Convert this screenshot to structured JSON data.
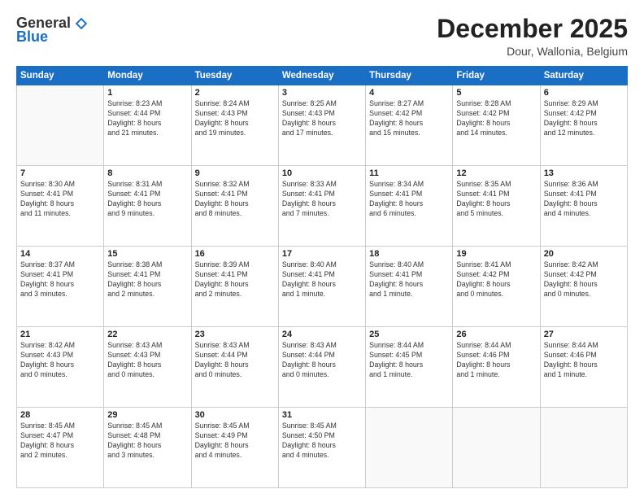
{
  "logo": {
    "general": "General",
    "blue": "Blue"
  },
  "title": "December 2025",
  "subtitle": "Dour, Wallonia, Belgium",
  "days_of_week": [
    "Sunday",
    "Monday",
    "Tuesday",
    "Wednesday",
    "Thursday",
    "Friday",
    "Saturday"
  ],
  "weeks": [
    [
      {
        "day": "",
        "info": ""
      },
      {
        "day": "1",
        "info": "Sunrise: 8:23 AM\nSunset: 4:44 PM\nDaylight: 8 hours\nand 21 minutes."
      },
      {
        "day": "2",
        "info": "Sunrise: 8:24 AM\nSunset: 4:43 PM\nDaylight: 8 hours\nand 19 minutes."
      },
      {
        "day": "3",
        "info": "Sunrise: 8:25 AM\nSunset: 4:43 PM\nDaylight: 8 hours\nand 17 minutes."
      },
      {
        "day": "4",
        "info": "Sunrise: 8:27 AM\nSunset: 4:42 PM\nDaylight: 8 hours\nand 15 minutes."
      },
      {
        "day": "5",
        "info": "Sunrise: 8:28 AM\nSunset: 4:42 PM\nDaylight: 8 hours\nand 14 minutes."
      },
      {
        "day": "6",
        "info": "Sunrise: 8:29 AM\nSunset: 4:42 PM\nDaylight: 8 hours\nand 12 minutes."
      }
    ],
    [
      {
        "day": "7",
        "info": "Sunrise: 8:30 AM\nSunset: 4:41 PM\nDaylight: 8 hours\nand 11 minutes."
      },
      {
        "day": "8",
        "info": "Sunrise: 8:31 AM\nSunset: 4:41 PM\nDaylight: 8 hours\nand 9 minutes."
      },
      {
        "day": "9",
        "info": "Sunrise: 8:32 AM\nSunset: 4:41 PM\nDaylight: 8 hours\nand 8 minutes."
      },
      {
        "day": "10",
        "info": "Sunrise: 8:33 AM\nSunset: 4:41 PM\nDaylight: 8 hours\nand 7 minutes."
      },
      {
        "day": "11",
        "info": "Sunrise: 8:34 AM\nSunset: 4:41 PM\nDaylight: 8 hours\nand 6 minutes."
      },
      {
        "day": "12",
        "info": "Sunrise: 8:35 AM\nSunset: 4:41 PM\nDaylight: 8 hours\nand 5 minutes."
      },
      {
        "day": "13",
        "info": "Sunrise: 8:36 AM\nSunset: 4:41 PM\nDaylight: 8 hours\nand 4 minutes."
      }
    ],
    [
      {
        "day": "14",
        "info": "Sunrise: 8:37 AM\nSunset: 4:41 PM\nDaylight: 8 hours\nand 3 minutes."
      },
      {
        "day": "15",
        "info": "Sunrise: 8:38 AM\nSunset: 4:41 PM\nDaylight: 8 hours\nand 2 minutes."
      },
      {
        "day": "16",
        "info": "Sunrise: 8:39 AM\nSunset: 4:41 PM\nDaylight: 8 hours\nand 2 minutes."
      },
      {
        "day": "17",
        "info": "Sunrise: 8:40 AM\nSunset: 4:41 PM\nDaylight: 8 hours\nand 1 minute."
      },
      {
        "day": "18",
        "info": "Sunrise: 8:40 AM\nSunset: 4:41 PM\nDaylight: 8 hours\nand 1 minute."
      },
      {
        "day": "19",
        "info": "Sunrise: 8:41 AM\nSunset: 4:42 PM\nDaylight: 8 hours\nand 0 minutes."
      },
      {
        "day": "20",
        "info": "Sunrise: 8:42 AM\nSunset: 4:42 PM\nDaylight: 8 hours\nand 0 minutes."
      }
    ],
    [
      {
        "day": "21",
        "info": "Sunrise: 8:42 AM\nSunset: 4:43 PM\nDaylight: 8 hours\nand 0 minutes."
      },
      {
        "day": "22",
        "info": "Sunrise: 8:43 AM\nSunset: 4:43 PM\nDaylight: 8 hours\nand 0 minutes."
      },
      {
        "day": "23",
        "info": "Sunrise: 8:43 AM\nSunset: 4:44 PM\nDaylight: 8 hours\nand 0 minutes."
      },
      {
        "day": "24",
        "info": "Sunrise: 8:43 AM\nSunset: 4:44 PM\nDaylight: 8 hours\nand 0 minutes."
      },
      {
        "day": "25",
        "info": "Sunrise: 8:44 AM\nSunset: 4:45 PM\nDaylight: 8 hours\nand 1 minute."
      },
      {
        "day": "26",
        "info": "Sunrise: 8:44 AM\nSunset: 4:46 PM\nDaylight: 8 hours\nand 1 minute."
      },
      {
        "day": "27",
        "info": "Sunrise: 8:44 AM\nSunset: 4:46 PM\nDaylight: 8 hours\nand 1 minute."
      }
    ],
    [
      {
        "day": "28",
        "info": "Sunrise: 8:45 AM\nSunset: 4:47 PM\nDaylight: 8 hours\nand 2 minutes."
      },
      {
        "day": "29",
        "info": "Sunrise: 8:45 AM\nSunset: 4:48 PM\nDaylight: 8 hours\nand 3 minutes."
      },
      {
        "day": "30",
        "info": "Sunrise: 8:45 AM\nSunset: 4:49 PM\nDaylight: 8 hours\nand 4 minutes."
      },
      {
        "day": "31",
        "info": "Sunrise: 8:45 AM\nSunset: 4:50 PM\nDaylight: 8 hours\nand 4 minutes."
      },
      {
        "day": "",
        "info": ""
      },
      {
        "day": "",
        "info": ""
      },
      {
        "day": "",
        "info": ""
      }
    ]
  ]
}
